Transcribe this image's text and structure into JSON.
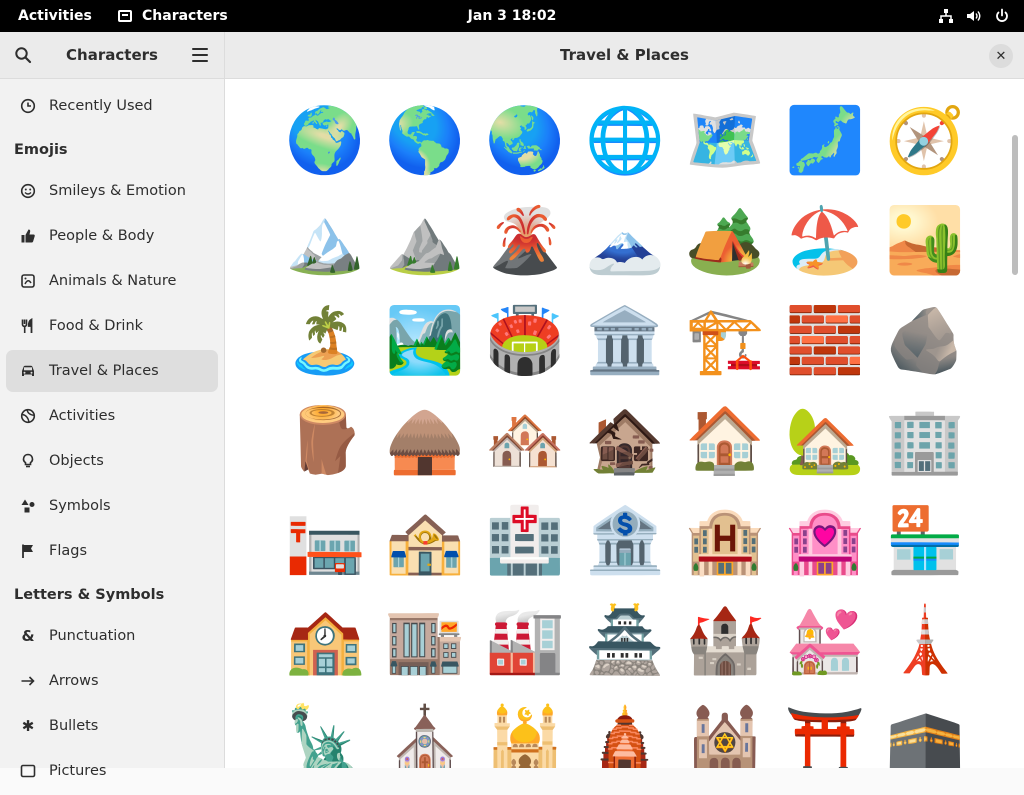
{
  "topbar": {
    "activities": "Activities",
    "app_name": "Characters",
    "clock": "Jan 3  18:02"
  },
  "sidebar": {
    "title": "Characters",
    "recently_used": "Recently Used",
    "sections": [
      {
        "title": "Emojis",
        "items": [
          {
            "label": "Smileys & Emotion",
            "icon": "smiley-icon"
          },
          {
            "label": "People & Body",
            "icon": "thumbs-up-icon"
          },
          {
            "label": "Animals & Nature",
            "icon": "paw-icon"
          },
          {
            "label": "Food & Drink",
            "icon": "fork-knife-icon"
          },
          {
            "label": "Travel & Places",
            "icon": "car-icon",
            "active": true
          },
          {
            "label": "Activities",
            "icon": "ball-icon"
          },
          {
            "label": "Objects",
            "icon": "bulb-icon"
          },
          {
            "label": "Symbols",
            "icon": "shapes-icon"
          },
          {
            "label": "Flags",
            "icon": "flag-icon"
          }
        ]
      },
      {
        "title": "Letters & Symbols",
        "items": [
          {
            "label": "Punctuation",
            "icon": "ampersand-icon"
          },
          {
            "label": "Arrows",
            "icon": "arrow-icon"
          },
          {
            "label": "Bullets",
            "icon": "bullet-icon"
          },
          {
            "label": "Pictures",
            "icon": "picture-icon"
          }
        ]
      }
    ]
  },
  "main": {
    "title": "Travel & Places",
    "emojis": [
      "🌍",
      "🌎",
      "🌏",
      "🌐",
      "🗺️",
      "🗾",
      "🧭",
      "🏔️",
      "⛰️",
      "🌋",
      "🗻",
      "🏕️",
      "🏖️",
      "🏜️",
      "🏝️",
      "🏞️",
      "🏟️",
      "🏛️",
      "🏗️",
      "🧱",
      "🪨",
      "🪵",
      "🛖",
      "🏘️",
      "🏚️",
      "🏠",
      "🏡",
      "🏢",
      "🏣",
      "🏤",
      "🏥",
      "🏦",
      "🏨",
      "🏩",
      "🏪",
      "🏫",
      "🏬",
      "🏭",
      "🏯",
      "🏰",
      "💒",
      "🗼",
      "🗽",
      "⛪",
      "🕌",
      "🛕",
      "🕍",
      "⛩️",
      "🕋"
    ]
  }
}
